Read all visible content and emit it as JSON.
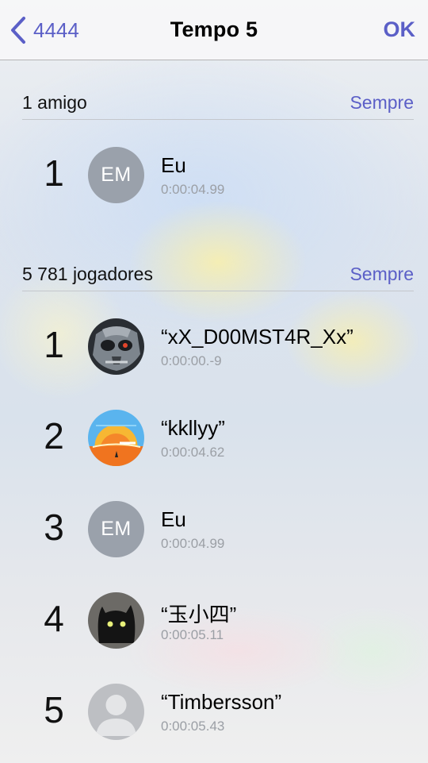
{
  "navbar": {
    "back_label": "4444",
    "title": "Tempo 5",
    "ok_label": "OK"
  },
  "friends": {
    "count": "1 amigo",
    "filter": "Sempre",
    "entries": [
      {
        "rank": "1",
        "initials": "EM",
        "name": "Eu",
        "time": "0:00:04.99"
      }
    ]
  },
  "players": {
    "count": "5 781 jogadores",
    "filter": "Sempre",
    "entries": [
      {
        "rank": "1",
        "avatar": "skull-avatar",
        "name": "“xX_D00MST4R_Xx”",
        "time": "0:00:00.-9"
      },
      {
        "rank": "2",
        "avatar": "sunset-avatar",
        "name": "“kkllyy”",
        "time": "0:00:04.62"
      },
      {
        "rank": "3",
        "initials": "EM",
        "name": "Eu",
        "time": "0:00:04.99"
      },
      {
        "rank": "4",
        "avatar": "black-cat-avatar",
        "name": "“玉小四”",
        "time": "0:00:05.11"
      },
      {
        "rank": "5",
        "avatar": "default-person-avatar",
        "name": "“Timbersson”",
        "time": "0:00:05.43"
      }
    ]
  },
  "colors": {
    "accent": "#5b5fc7",
    "secondary_text": "#9b9fa5",
    "initials_bg": "#9aa1ab"
  }
}
